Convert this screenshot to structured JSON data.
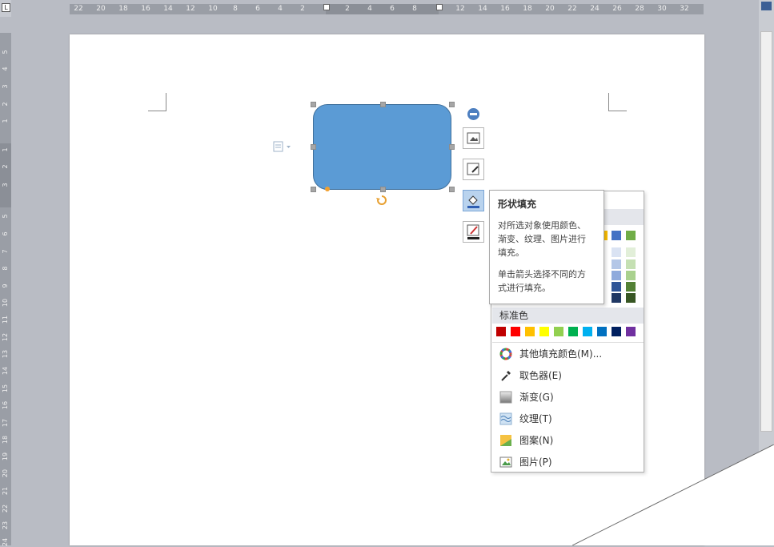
{
  "ruler": {
    "corner": "L",
    "horizontal_ticks": [
      "22",
      "20",
      "18",
      "16",
      "14",
      "12",
      "10",
      "8",
      "6",
      "4",
      "2",
      "2",
      "4",
      "6",
      "8",
      "12",
      "14",
      "16",
      "18",
      "20",
      "22",
      "24",
      "26",
      "28",
      "30",
      "32"
    ],
    "vertical_ticks": [
      "5",
      "4",
      "3",
      "2",
      "1",
      "1",
      "2",
      "3",
      "5",
      "6",
      "7",
      "8",
      "9",
      "10",
      "11",
      "12",
      "13",
      "14",
      "15",
      "16",
      "17",
      "18",
      "19",
      "20",
      "21",
      "22",
      "23",
      "24"
    ]
  },
  "tooltip": {
    "title": "形状填充",
    "line1": "对所选对象使用颜色、",
    "line2": "渐变、纹理、图片进行",
    "line3": "填充。",
    "line4": "单击箭头选择不同的方",
    "line5": "式进行填充。"
  },
  "menu": {
    "standard_colors_label": "标准色",
    "standard_colors": [
      "#c00000",
      "#ff0000",
      "#ffc000",
      "#ffff00",
      "#92d050",
      "#00b050",
      "#00b0f0",
      "#0070c0",
      "#002060",
      "#7030a0"
    ],
    "theme_top_colors": [
      "#ffc000",
      "#4472c4",
      "#70ad47"
    ],
    "theme_shade_colors": [
      [
        "#dae3f3",
        "#e2efd9"
      ],
      [
        "#b4c7e7",
        "#c5e0b3"
      ],
      [
        "#8faadc",
        "#a9d18e"
      ],
      [
        "#2f5597",
        "#538135"
      ],
      [
        "#203864",
        "#375623"
      ]
    ],
    "items": [
      {
        "label": "其他填充颜色(M)...",
        "icon": "color-wheel-icon"
      },
      {
        "label": "取色器(E)",
        "icon": "eyedropper-icon"
      },
      {
        "label": "渐变(G)",
        "icon": "gradient-icon"
      },
      {
        "label": "纹理(T)",
        "icon": "texture-icon"
      },
      {
        "label": "图案(N)",
        "icon": "pattern-icon"
      },
      {
        "label": "图片(P)",
        "icon": "picture-icon"
      }
    ]
  },
  "shape": {
    "fill": "#5b9bd5"
  }
}
